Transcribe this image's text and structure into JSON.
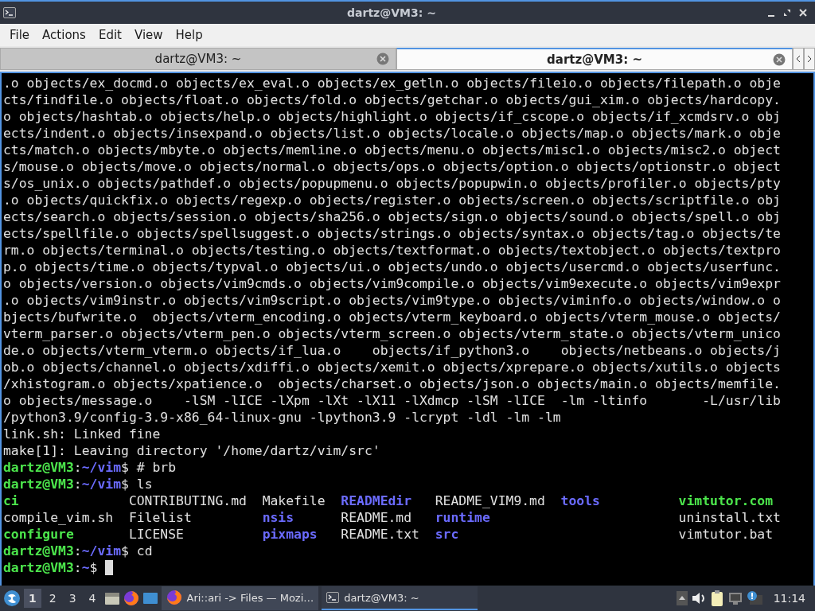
{
  "window": {
    "title": "dartz@VM3: ~"
  },
  "menu": [
    "File",
    "Actions",
    "Edit",
    "View",
    "Help"
  ],
  "tabs": [
    {
      "label": "dartz@VM3: ~",
      "selected": false
    },
    {
      "label": "dartz@VM3: ~",
      "selected": true
    }
  ],
  "terminal": {
    "lines": [
      [
        {
          "kind": "text",
          "text": ".o objects/ex_docmd.o objects/ex_eval.o objects/ex_getln.o objects/fileio.o objects/filepath.o obje"
        }
      ],
      [
        {
          "kind": "text",
          "text": "cts/findfile.o objects/float.o objects/fold.o objects/getchar.o objects/gui_xim.o objects/hardcopy."
        }
      ],
      [
        {
          "kind": "text",
          "text": "o objects/hashtab.o objects/help.o objects/highlight.o objects/if_cscope.o objects/if_xcmdsrv.o obj"
        }
      ],
      [
        {
          "kind": "text",
          "text": "ects/indent.o objects/insexpand.o objects/list.o objects/locale.o objects/map.o objects/mark.o obje"
        }
      ],
      [
        {
          "kind": "text",
          "text": "cts/match.o objects/mbyte.o objects/memline.o objects/menu.o objects/misc1.o objects/misc2.o object"
        }
      ],
      [
        {
          "kind": "text",
          "text": "s/mouse.o objects/move.o objects/normal.o objects/ops.o objects/option.o objects/optionstr.o object"
        }
      ],
      [
        {
          "kind": "text",
          "text": "s/os_unix.o objects/pathdef.o objects/popupmenu.o objects/popupwin.o objects/profiler.o objects/pty"
        }
      ],
      [
        {
          "kind": "text",
          "text": ".o objects/quickfix.o objects/regexp.o objects/register.o objects/screen.o objects/scriptfile.o obj"
        }
      ],
      [
        {
          "kind": "text",
          "text": "ects/search.o objects/session.o objects/sha256.o objects/sign.o objects/sound.o objects/spell.o obj"
        }
      ],
      [
        {
          "kind": "text",
          "text": "ects/spellfile.o objects/spellsuggest.o objects/strings.o objects/syntax.o objects/tag.o objects/te"
        }
      ],
      [
        {
          "kind": "text",
          "text": "rm.o objects/terminal.o objects/testing.o objects/textformat.o objects/textobject.o objects/textpro"
        }
      ],
      [
        {
          "kind": "text",
          "text": "p.o objects/time.o objects/typval.o objects/ui.o objects/undo.o objects/usercmd.o objects/userfunc."
        }
      ],
      [
        {
          "kind": "text",
          "text": "o objects/version.o objects/vim9cmds.o objects/vim9compile.o objects/vim9execute.o objects/vim9expr"
        }
      ],
      [
        {
          "kind": "text",
          "text": ".o objects/vim9instr.o objects/vim9script.o objects/vim9type.o objects/viminfo.o objects/window.o o"
        }
      ],
      [
        {
          "kind": "text",
          "text": "bjects/bufwrite.o  objects/vterm_encoding.o objects/vterm_keyboard.o objects/vterm_mouse.o objects/"
        }
      ],
      [
        {
          "kind": "text",
          "text": "vterm_parser.o objects/vterm_pen.o objects/vterm_screen.o objects/vterm_state.o objects/vterm_unico"
        }
      ],
      [
        {
          "kind": "text",
          "text": "de.o objects/vterm_vterm.o objects/if_lua.o    objects/if_python3.o    objects/netbeans.o objects/j"
        }
      ],
      [
        {
          "kind": "text",
          "text": "ob.o objects/channel.o objects/xdiffi.o objects/xemit.o objects/xprepare.o objects/xutils.o objects"
        }
      ],
      [
        {
          "kind": "text",
          "text": "/xhistogram.o objects/xpatience.o  objects/charset.o objects/json.o objects/main.o objects/memfile."
        }
      ],
      [
        {
          "kind": "text",
          "text": "o objects/message.o    -lSM -lICE -lXpm -lXt -lX11 -lXdmcp -lSM -lICE  -lm -ltinfo       -L/usr/lib"
        }
      ],
      [
        {
          "kind": "text",
          "text": "/python3.9/config-3.9-x86_64-linux-gnu -lpython3.9 -lcrypt -ldl -lm -lm"
        }
      ],
      [
        {
          "kind": "text",
          "text": "link.sh: Linked fine"
        }
      ],
      [
        {
          "kind": "text",
          "text": "make[1]: Leaving directory '/home/dartz/vim/src'"
        }
      ],
      [
        {
          "kind": "user",
          "text": "dartz@VM3"
        },
        {
          "kind": "text",
          "text": ":"
        },
        {
          "kind": "path",
          "text": "~/vim"
        },
        {
          "kind": "text",
          "text": "$ # brb"
        }
      ],
      [
        {
          "kind": "user",
          "text": "dartz@VM3"
        },
        {
          "kind": "text",
          "text": ":"
        },
        {
          "kind": "path",
          "text": "~/vim"
        },
        {
          "kind": "text",
          "text": "$ ls"
        }
      ]
    ],
    "listing": [
      [
        {
          "kind": "exec",
          "text": "ci"
        },
        {
          "kind": "text",
          "text": "CONTRIBUTING.md"
        },
        {
          "kind": "text",
          "text": "Makefile"
        },
        {
          "kind": "dir",
          "text": "READMEdir"
        },
        {
          "kind": "text",
          "text": "README_VIM9.md"
        },
        {
          "kind": "dir",
          "text": "tools"
        },
        {
          "kind": "exec",
          "text": "vimtutor.com"
        }
      ],
      [
        {
          "kind": "text",
          "text": "compile_vim.sh"
        },
        {
          "kind": "text",
          "text": "Filelist"
        },
        {
          "kind": "dir",
          "text": "nsis"
        },
        {
          "kind": "text",
          "text": "README.md"
        },
        {
          "kind": "dir",
          "text": "runtime"
        },
        {
          "kind": "text",
          "text": "uninstall.txt"
        }
      ],
      [
        {
          "kind": "exec",
          "text": "configure"
        },
        {
          "kind": "text",
          "text": "LICENSE"
        },
        {
          "kind": "dir",
          "text": "pixmaps"
        },
        {
          "kind": "text",
          "text": "README.txt"
        },
        {
          "kind": "dir",
          "text": "src"
        },
        {
          "kind": "text",
          "text": "vimtutor.bat"
        }
      ]
    ],
    "after": [
      [
        {
          "kind": "user",
          "text": "dartz@VM3"
        },
        {
          "kind": "text",
          "text": ":"
        },
        {
          "kind": "path",
          "text": "~/vim"
        },
        {
          "kind": "text",
          "text": "$ cd"
        }
      ],
      [
        {
          "kind": "user",
          "text": "dartz@VM3"
        },
        {
          "kind": "text",
          "text": ":"
        },
        {
          "kind": "path",
          "text": "~"
        },
        {
          "kind": "text",
          "text": "$"
        }
      ]
    ]
  },
  "taskbar": {
    "workspaces": [
      {
        "label": "1",
        "selected": true
      },
      {
        "label": "2",
        "selected": false
      },
      {
        "label": "3",
        "selected": false
      },
      {
        "label": "4",
        "selected": false
      }
    ],
    "tasks": [
      {
        "label": "Ari::ari -> Files — Mozi…",
        "kind": "browser",
        "selected": false
      },
      {
        "label": "dartz@VM3: ~",
        "kind": "terminal",
        "selected": true
      }
    ],
    "clock": "11:14"
  }
}
